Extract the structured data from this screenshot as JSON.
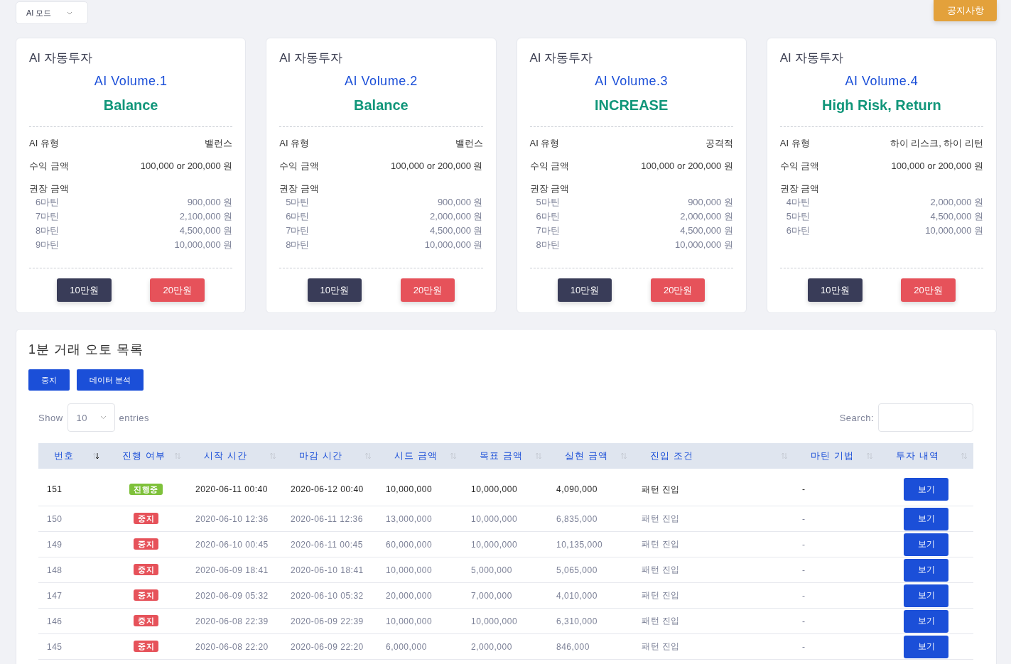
{
  "mode_select": {
    "value": "AI 모드"
  },
  "notice_button": "공지사항",
  "cards": [
    {
      "heading": "AI 자동투자",
      "volume": "AI Volume.1",
      "style": "Balance",
      "type_label": "AI 유형",
      "type_value": "밸런스",
      "profit_label": "수익 금액",
      "profit_value": "100,000 or 200,000 원",
      "recommend_label": "권장 금액",
      "recommend": [
        {
          "label": "6마틴",
          "amount": "900,000 원"
        },
        {
          "label": "7마틴",
          "amount": "2,100,000 원"
        },
        {
          "label": "8마틴",
          "amount": "4,500,000 원"
        },
        {
          "label": "9마틴",
          "amount": "10,000,000 원"
        }
      ],
      "buttons": [
        {
          "label": "10만원",
          "kind": "dark"
        },
        {
          "label": "20만원",
          "kind": "danger"
        }
      ]
    },
    {
      "heading": "AI 자동투자",
      "volume": "AI Volume.2",
      "style": "Balance",
      "type_label": "AI 유형",
      "type_value": "밸런스",
      "profit_label": "수익 금액",
      "profit_value": "100,000 or 200,000 원",
      "recommend_label": "권장 금액",
      "recommend": [
        {
          "label": "5마틴",
          "amount": "900,000 원"
        },
        {
          "label": "6마틴",
          "amount": "2,000,000 원"
        },
        {
          "label": "7마틴",
          "amount": "4,500,000 원"
        },
        {
          "label": "8마틴",
          "amount": "10,000,000 원"
        }
      ],
      "buttons": [
        {
          "label": "10만원",
          "kind": "dark"
        },
        {
          "label": "20만원",
          "kind": "danger"
        }
      ]
    },
    {
      "heading": "AI 자동투자",
      "volume": "AI Volume.3",
      "style": "INCREASE",
      "type_label": "AI 유형",
      "type_value": "공격적",
      "profit_label": "수익 금액",
      "profit_value": "100,000 or 200,000 원",
      "recommend_label": "권장 금액",
      "recommend": [
        {
          "label": "5마틴",
          "amount": "900,000 원"
        },
        {
          "label": "6마틴",
          "amount": "2,000,000 원"
        },
        {
          "label": "7마틴",
          "amount": "4,500,000 원"
        },
        {
          "label": "8마틴",
          "amount": "10,000,000 원"
        }
      ],
      "buttons": [
        {
          "label": "10만원",
          "kind": "dark"
        },
        {
          "label": "20만원",
          "kind": "danger"
        }
      ]
    },
    {
      "heading": "AI 자동투자",
      "volume": "AI Volume.4",
      "style": "High Risk, Return",
      "type_label": "AI 유형",
      "type_value": "하이 리스크, 하이 리턴",
      "profit_label": "수익 금액",
      "profit_value": "100,000 or 200,000 원",
      "recommend_label": "권장 금액",
      "recommend": [
        {
          "label": "4마틴",
          "amount": "2,000,000 원"
        },
        {
          "label": "5마틴",
          "amount": "4,500,000 원"
        },
        {
          "label": "6마틴",
          "amount": "10,000,000 원"
        }
      ],
      "buttons": [
        {
          "label": "10만원",
          "kind": "dark"
        },
        {
          "label": "20만원",
          "kind": "danger"
        }
      ]
    }
  ],
  "list": {
    "title": "1분 거래 오토 목록",
    "actions": [
      "중지",
      "데이터 분석"
    ],
    "show_label": "Show",
    "page_size": "10",
    "entries_label": "entries",
    "search_label": "Search:",
    "table": {
      "columns": [
        {
          "label": "번호",
          "sorted": true
        },
        {
          "label": "진행 여부",
          "sorted": false
        },
        {
          "label": "시작 시간",
          "sorted": false
        },
        {
          "label": "마감 시간",
          "sorted": false
        },
        {
          "label": "시드 금액",
          "sorted": false
        },
        {
          "label": "목표 금액",
          "sorted": false
        },
        {
          "label": "실현 금액",
          "sorted": false
        },
        {
          "label": "진입 조건",
          "sorted": false
        },
        {
          "label": "마틴 기법",
          "sorted": false
        },
        {
          "label": "투자 내역",
          "sorted": false
        }
      ],
      "rows": [
        {
          "no": "151",
          "status": "진행중",
          "kind": "running",
          "start": "2020-06-11 00:40",
          "end": "2020-06-12 00:40",
          "seed": "10,000,000",
          "target": "10,000,000",
          "realized": "4,090,000",
          "entry": "패턴 진입",
          "martin": "-",
          "action": "보기"
        },
        {
          "no": "150",
          "status": "중지",
          "kind": "stopped",
          "start": "2020-06-10 12:36",
          "end": "2020-06-11 12:36",
          "seed": "13,000,000",
          "target": "10,000,000",
          "realized": "6,835,000",
          "entry": "패턴 진입",
          "martin": "-",
          "action": "보기"
        },
        {
          "no": "149",
          "status": "중지",
          "kind": "stopped",
          "start": "2020-06-10 00:45",
          "end": "2020-06-11 00:45",
          "seed": "60,000,000",
          "target": "10,000,000",
          "realized": "10,135,000",
          "entry": "패턴 진입",
          "martin": "-",
          "action": "보기"
        },
        {
          "no": "148",
          "status": "중지",
          "kind": "stopped",
          "start": "2020-06-09 18:41",
          "end": "2020-06-10 18:41",
          "seed": "10,000,000",
          "target": "5,000,000",
          "realized": "5,065,000",
          "entry": "패턴 진입",
          "martin": "-",
          "action": "보기"
        },
        {
          "no": "147",
          "status": "중지",
          "kind": "stopped",
          "start": "2020-06-09 05:32",
          "end": "2020-06-10 05:32",
          "seed": "20,000,000",
          "target": "7,000,000",
          "realized": "4,010,000",
          "entry": "패턴 진입",
          "martin": "-",
          "action": "보기"
        },
        {
          "no": "146",
          "status": "중지",
          "kind": "stopped",
          "start": "2020-06-08 22:39",
          "end": "2020-06-09 22:39",
          "seed": "10,000,000",
          "target": "10,000,000",
          "realized": "6,310,000",
          "entry": "패턴 진입",
          "martin": "-",
          "action": "보기"
        },
        {
          "no": "145",
          "status": "중지",
          "kind": "stopped",
          "start": "2020-06-08 22:20",
          "end": "2020-06-09 22:20",
          "seed": "6,000,000",
          "target": "2,000,000",
          "realized": "846,000",
          "entry": "패턴 진입",
          "martin": "-",
          "action": "보기"
        }
      ]
    }
  }
}
